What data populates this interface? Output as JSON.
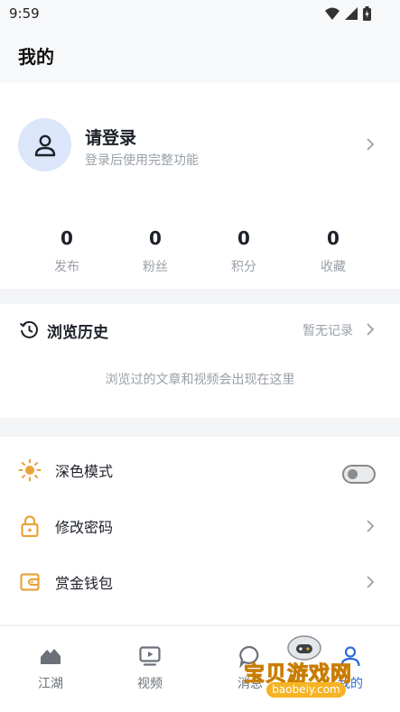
{
  "status_bar": {
    "time": "9:59"
  },
  "header": {
    "title": "我的"
  },
  "profile": {
    "title": "请登录",
    "subtitle": "登录后使用完整功能"
  },
  "stats": [
    {
      "value": "0",
      "label": "发布"
    },
    {
      "value": "0",
      "label": "粉丝"
    },
    {
      "value": "0",
      "label": "积分"
    },
    {
      "value": "0",
      "label": "收藏"
    }
  ],
  "history": {
    "title": "浏览历史",
    "status": "暂无记录",
    "empty": "浏览过的文章和视频会出现在这里"
  },
  "settings": [
    {
      "label": "深色模式",
      "icon": "sun-icon",
      "toggle_on": false
    },
    {
      "label": "修改密码",
      "icon": "lock-icon"
    },
    {
      "label": "赏金钱包",
      "icon": "wallet-icon"
    }
  ],
  "tabs": [
    {
      "label": "江湖",
      "icon": "home-icon",
      "active": false
    },
    {
      "label": "视频",
      "icon": "tv-icon",
      "active": false
    },
    {
      "label": "消息",
      "icon": "message-icon",
      "active": false
    },
    {
      "label": "我的",
      "icon": "profile-icon",
      "active": true
    }
  ],
  "watermark": {
    "text": "宝贝游戏网",
    "url": "baobeiy.com"
  },
  "colors": {
    "accent": "#2f6bd9",
    "icon_orange": "#e8a33a",
    "muted": "#9aa0a8"
  }
}
